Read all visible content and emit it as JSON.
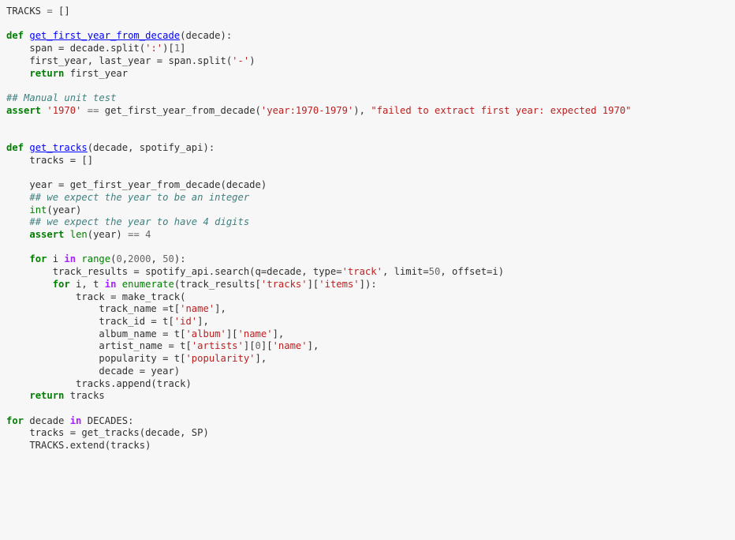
{
  "editor": {
    "language": "python",
    "background_color": "#f7f7f7",
    "default_text_color": "#303030",
    "font_size_px": 12,
    "line_height_px": 16,
    "theme": {
      "keyword_color": "#008000",
      "operator_word_color": "#aa22ff",
      "function_name_color": "#0000ff",
      "builtin_color": "#008000",
      "string_color": "#ba2121",
      "comment_color": "#408080",
      "operator_color": "#666666"
    }
  },
  "code": {
    "lines": [
      "TRACKS = []",
      "",
      "def get_first_year_from_decade(decade):",
      "    span = decade.split(':')[1]",
      "    first_year, last_year = span.split('-')",
      "    return first_year",
      "",
      "## Manual unit test",
      "assert '1970' == get_first_year_from_decade('year:1970-1979'), \"failed to extract first year: expected 1970\"",
      "",
      "",
      "def get_tracks(decade, spotify_api):",
      "    tracks = []",
      "",
      "    year = get_first_year_from_decade(decade)",
      "    ## we expect the year to be an integer",
      "    int(year)",
      "    ## we expect the year to have 4 digits",
      "    assert len(year) == 4",
      "",
      "    for i in range(0,2000, 50):",
      "        track_results = spotify_api.search(q=decade, type='track', limit=50, offset=i)",
      "        for i, t in enumerate(track_results['tracks']['items']):",
      "            track = make_track(",
      "                track_name =t['name'],",
      "                track_id = t['id'],",
      "                album_name = t['album']['name'],",
      "                artist_name = t['artists'][0]['name'],",
      "                popularity = t['popularity'],",
      "                decade = year)",
      "            tracks.append(track)",
      "    return tracks",
      "",
      "for decade in DECADES:",
      "    tracks = get_tracks(decade, SP)",
      "    TRACKS.extend(tracks)"
    ],
    "tokens": [
      [
        [
          "n",
          "TRACKS"
        ],
        [
          "o",
          " = "
        ],
        [
          "n",
          "[]"
        ]
      ],
      [],
      [
        [
          "k",
          "def"
        ],
        [
          "n",
          " "
        ],
        [
          "nf",
          "get_first_year_from_decade"
        ],
        [
          "n",
          "(decade):"
        ]
      ],
      [
        [
          "n",
          "    span = decade.split("
        ],
        [
          "s",
          "':'"
        ],
        [
          "n",
          ")["
        ],
        [
          "mi",
          "1"
        ],
        [
          "n",
          "]"
        ]
      ],
      [
        [
          "n",
          "    first_year, last_year = span.split("
        ],
        [
          "s",
          "'-'"
        ],
        [
          "n",
          ")"
        ]
      ],
      [
        [
          "n",
          "    "
        ],
        [
          "k",
          "return"
        ],
        [
          "n",
          " first_year"
        ]
      ],
      [],
      [
        [
          "c",
          "## Manual unit test"
        ]
      ],
      [
        [
          "k",
          "assert"
        ],
        [
          "n",
          " "
        ],
        [
          "s",
          "'1970'"
        ],
        [
          "o",
          " == "
        ],
        [
          "n",
          "get_first_year_from_decade("
        ],
        [
          "s",
          "'year:1970-1979'"
        ],
        [
          "n",
          "), "
        ],
        [
          "s",
          "\"failed to extract first year: expected 1970\""
        ]
      ],
      [],
      [],
      [
        [
          "k",
          "def"
        ],
        [
          "n",
          " "
        ],
        [
          "nf",
          "get_tracks"
        ],
        [
          "n",
          "(decade, spotify_api):"
        ]
      ],
      [
        [
          "n",
          "    tracks = []"
        ]
      ],
      [],
      [
        [
          "n",
          "    year = get_first_year_from_decade(decade)"
        ]
      ],
      [
        [
          "n",
          "    "
        ],
        [
          "c",
          "## we expect the year to be an integer"
        ]
      ],
      [
        [
          "n",
          "    "
        ],
        [
          "nb",
          "int"
        ],
        [
          "n",
          "(year)"
        ]
      ],
      [
        [
          "n",
          "    "
        ],
        [
          "c",
          "## we expect the year to have 4 digits"
        ]
      ],
      [
        [
          "n",
          "    "
        ],
        [
          "k",
          "assert"
        ],
        [
          "n",
          " "
        ],
        [
          "nb",
          "len"
        ],
        [
          "n",
          "(year) "
        ],
        [
          "o",
          "== "
        ],
        [
          "mi",
          "4"
        ]
      ],
      [],
      [
        [
          "n",
          "    "
        ],
        [
          "k",
          "for"
        ],
        [
          "n",
          " i "
        ],
        [
          "ow",
          "in"
        ],
        [
          "n",
          " "
        ],
        [
          "nb",
          "range"
        ],
        [
          "n",
          "("
        ],
        [
          "mi",
          "0"
        ],
        [
          "n",
          ","
        ],
        [
          "mi",
          "2000"
        ],
        [
          "n",
          ", "
        ],
        [
          "mi",
          "50"
        ],
        [
          "n",
          "):"
        ]
      ],
      [
        [
          "n",
          "        track_results = spotify_api.search(q=decade, type="
        ],
        [
          "s",
          "'track'"
        ],
        [
          "n",
          ", limit="
        ],
        [
          "mi",
          "50"
        ],
        [
          "n",
          ", offset=i)"
        ]
      ],
      [
        [
          "n",
          "        "
        ],
        [
          "k",
          "for"
        ],
        [
          "n",
          " i, t "
        ],
        [
          "ow",
          "in"
        ],
        [
          "n",
          " "
        ],
        [
          "nb",
          "enumerate"
        ],
        [
          "n",
          "(track_results["
        ],
        [
          "s",
          "'tracks'"
        ],
        [
          "n",
          "]["
        ],
        [
          "s",
          "'items'"
        ],
        [
          "n",
          "]):"
        ]
      ],
      [
        [
          "n",
          "            track = make_track("
        ]
      ],
      [
        [
          "n",
          "                track_name =t["
        ],
        [
          "s",
          "'name'"
        ],
        [
          "n",
          "],"
        ]
      ],
      [
        [
          "n",
          "                track_id = t["
        ],
        [
          "s",
          "'id'"
        ],
        [
          "n",
          "],"
        ]
      ],
      [
        [
          "n",
          "                album_name = t["
        ],
        [
          "s",
          "'album'"
        ],
        [
          "n",
          "]["
        ],
        [
          "s",
          "'name'"
        ],
        [
          "n",
          "],"
        ]
      ],
      [
        [
          "n",
          "                artist_name = t["
        ],
        [
          "s",
          "'artists'"
        ],
        [
          "n",
          "]["
        ],
        [
          "mi",
          "0"
        ],
        [
          "n",
          "]["
        ],
        [
          "s",
          "'name'"
        ],
        [
          "n",
          "],"
        ]
      ],
      [
        [
          "n",
          "                popularity = t["
        ],
        [
          "s",
          "'popularity'"
        ],
        [
          "n",
          "],"
        ]
      ],
      [
        [
          "n",
          "                decade = year)"
        ]
      ],
      [
        [
          "n",
          "            tracks.append(track)"
        ]
      ],
      [
        [
          "n",
          "    "
        ],
        [
          "k",
          "return"
        ],
        [
          "n",
          " tracks"
        ]
      ],
      [],
      [
        [
          "k",
          "for"
        ],
        [
          "n",
          " decade "
        ],
        [
          "ow",
          "in"
        ],
        [
          "n",
          " DECADES:"
        ]
      ],
      [
        [
          "n",
          "    tracks = get_tracks(decade, SP)"
        ]
      ],
      [
        [
          "n",
          "    TRACKS.extend(tracks)"
        ]
      ]
    ]
  }
}
